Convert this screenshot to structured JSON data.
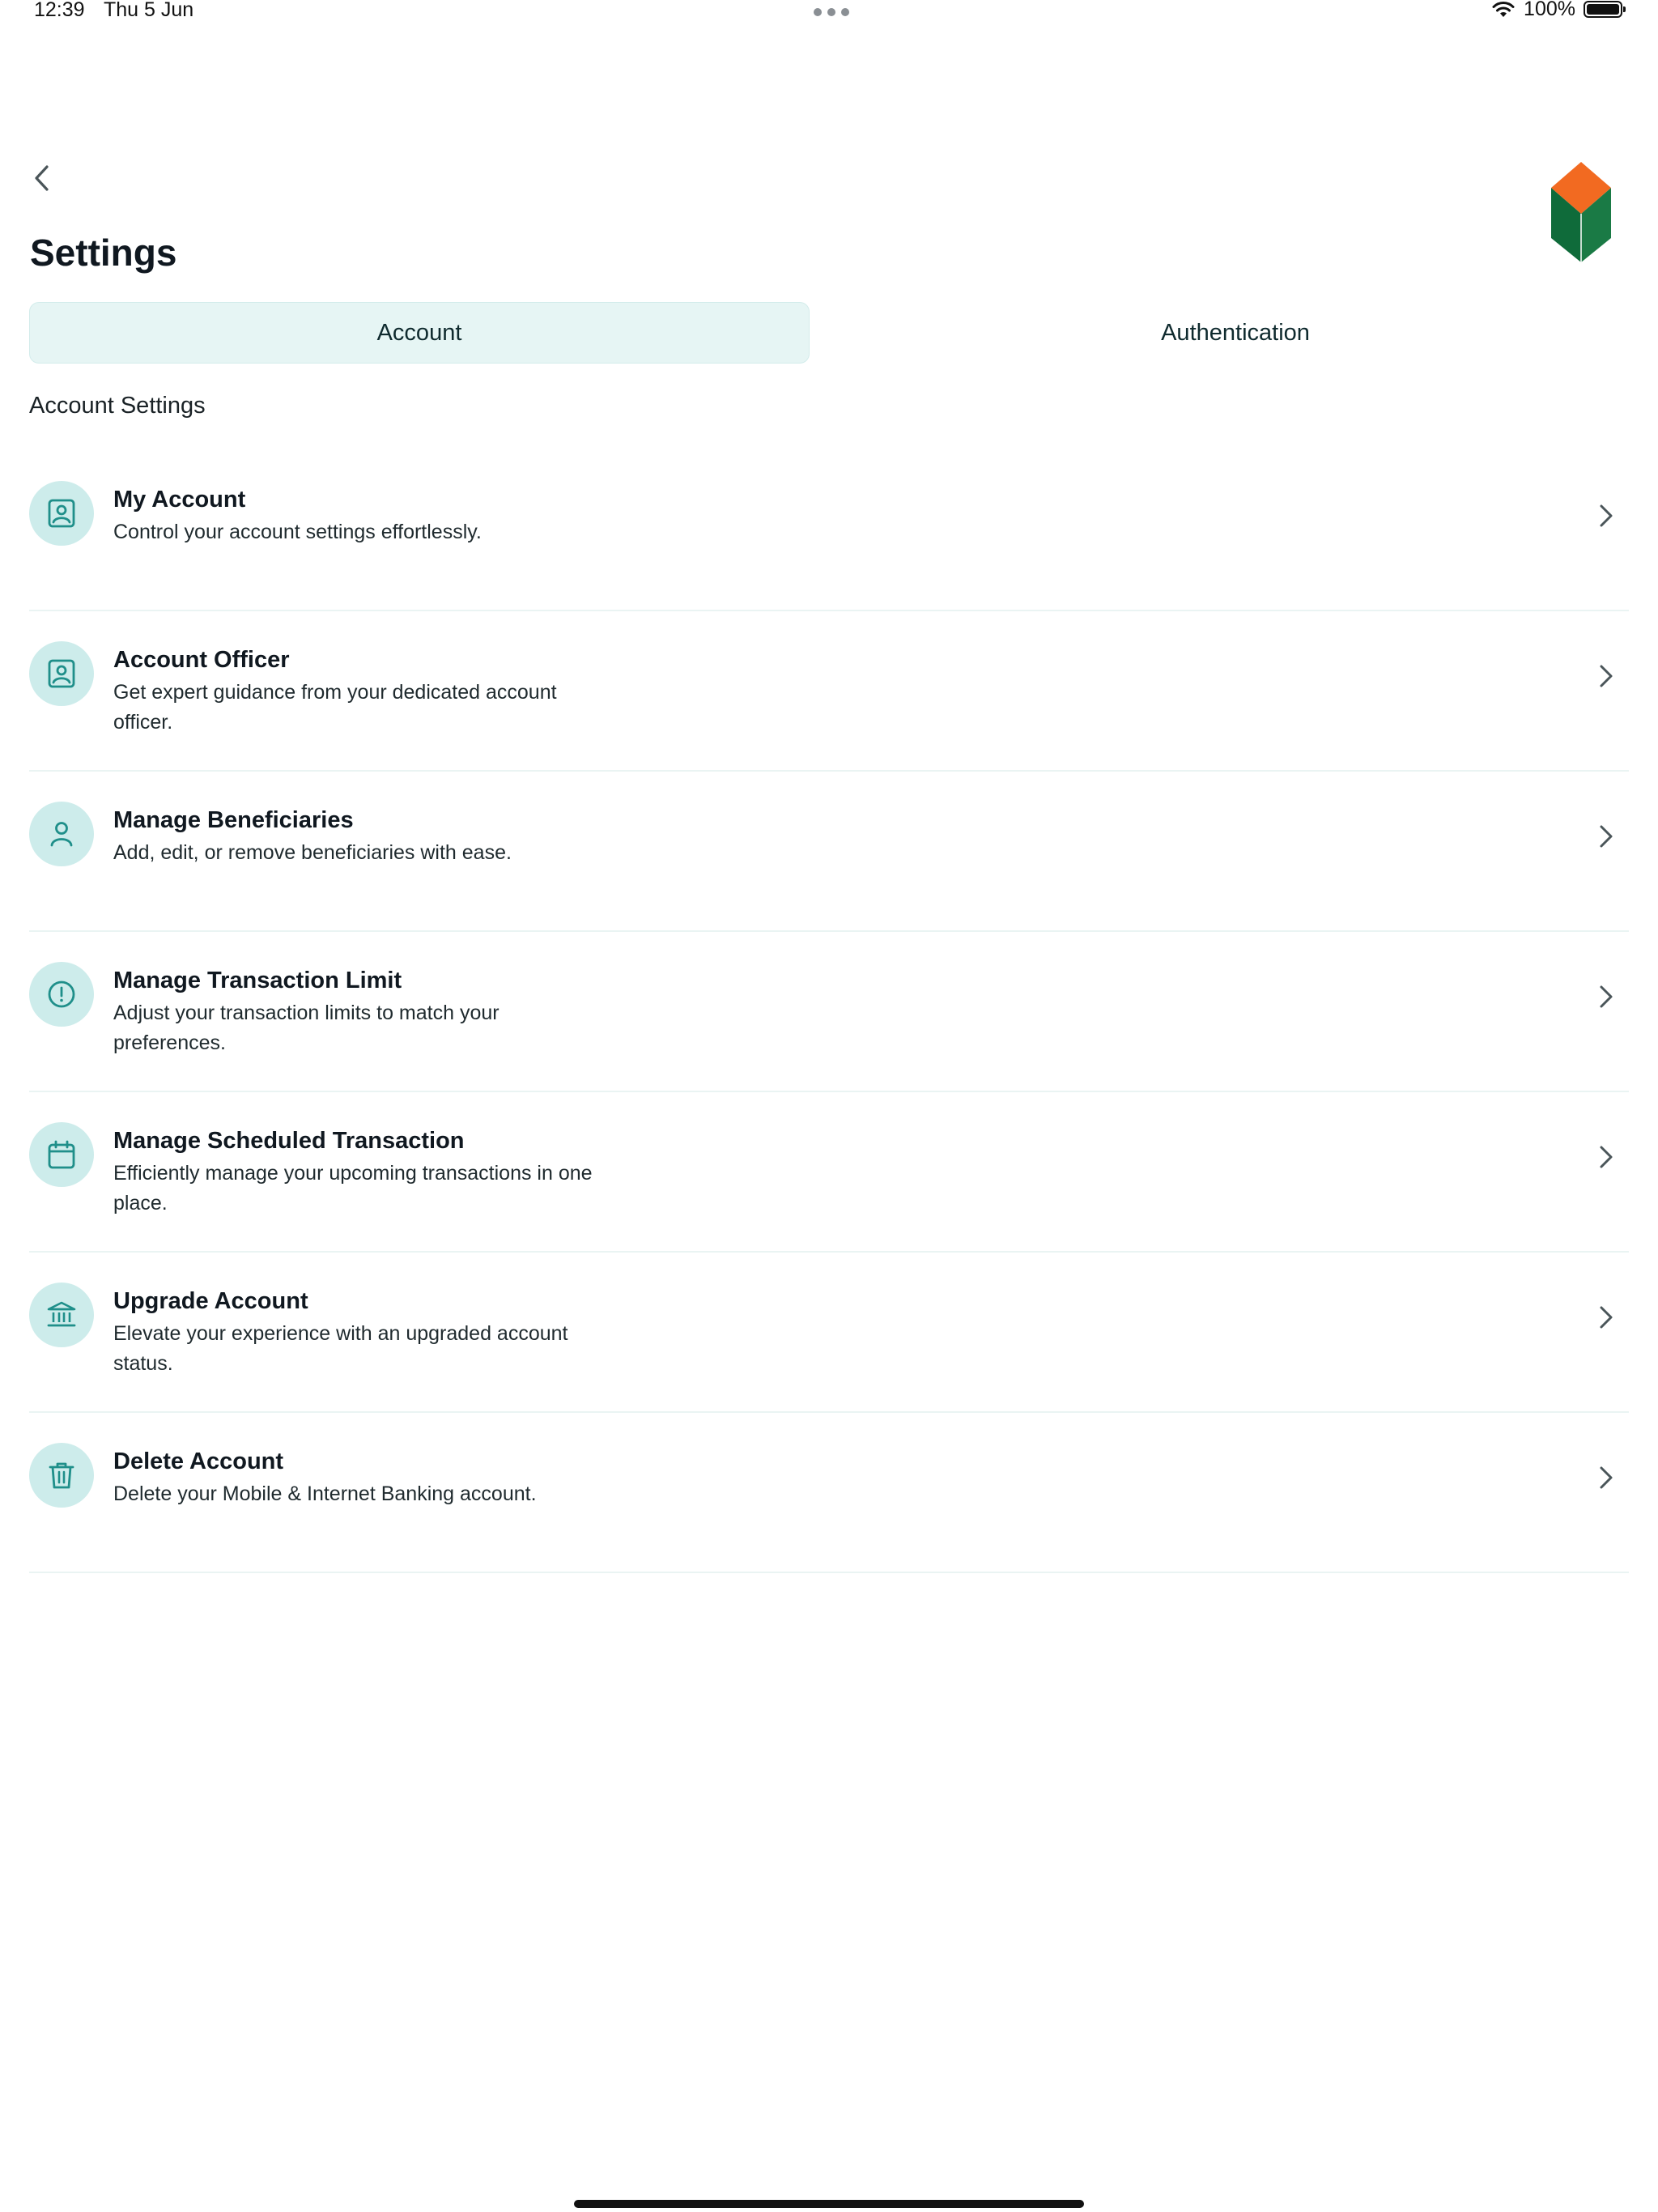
{
  "status_bar": {
    "time": "12:39",
    "date": "Thu 5 Jun",
    "battery": "100%",
    "battery_level": 1.0
  },
  "header": {
    "title": "Settings"
  },
  "tabs": [
    {
      "label": "Account",
      "active": true
    },
    {
      "label": "Authentication",
      "active": false
    }
  ],
  "section": {
    "title": "Account Settings"
  },
  "items": [
    {
      "icon": "user-card-icon",
      "title": "My Account",
      "description": "Control your account settings effortlessly."
    },
    {
      "icon": "user-card-icon",
      "title": "Account Officer",
      "description": "Get expert guidance from your dedicated account officer."
    },
    {
      "icon": "person-icon",
      "title": "Manage Beneficiaries",
      "description": "Add, edit, or remove beneficiaries with ease."
    },
    {
      "icon": "alert-circle-icon",
      "title": "Manage Transaction Limit",
      "description": "Adjust your transaction limits to match your preferences."
    },
    {
      "icon": "calendar-icon",
      "title": "Manage Scheduled Transaction",
      "description": "Efficiently manage your upcoming transactions in one place."
    },
    {
      "icon": "bank-icon",
      "title": "Upgrade Account",
      "description": "Elevate your experience with an upgraded account status."
    },
    {
      "icon": "trash-icon",
      "title": "Delete Account",
      "description": "Delete your Mobile & Internet Banking account."
    }
  ],
  "colors": {
    "accent": "#1f8f8a",
    "icon_bg": "#cdeceb",
    "tab_active_bg": "#e6f5f4",
    "logo_orange": "#f26a21",
    "logo_green": "#0f6b3a"
  }
}
